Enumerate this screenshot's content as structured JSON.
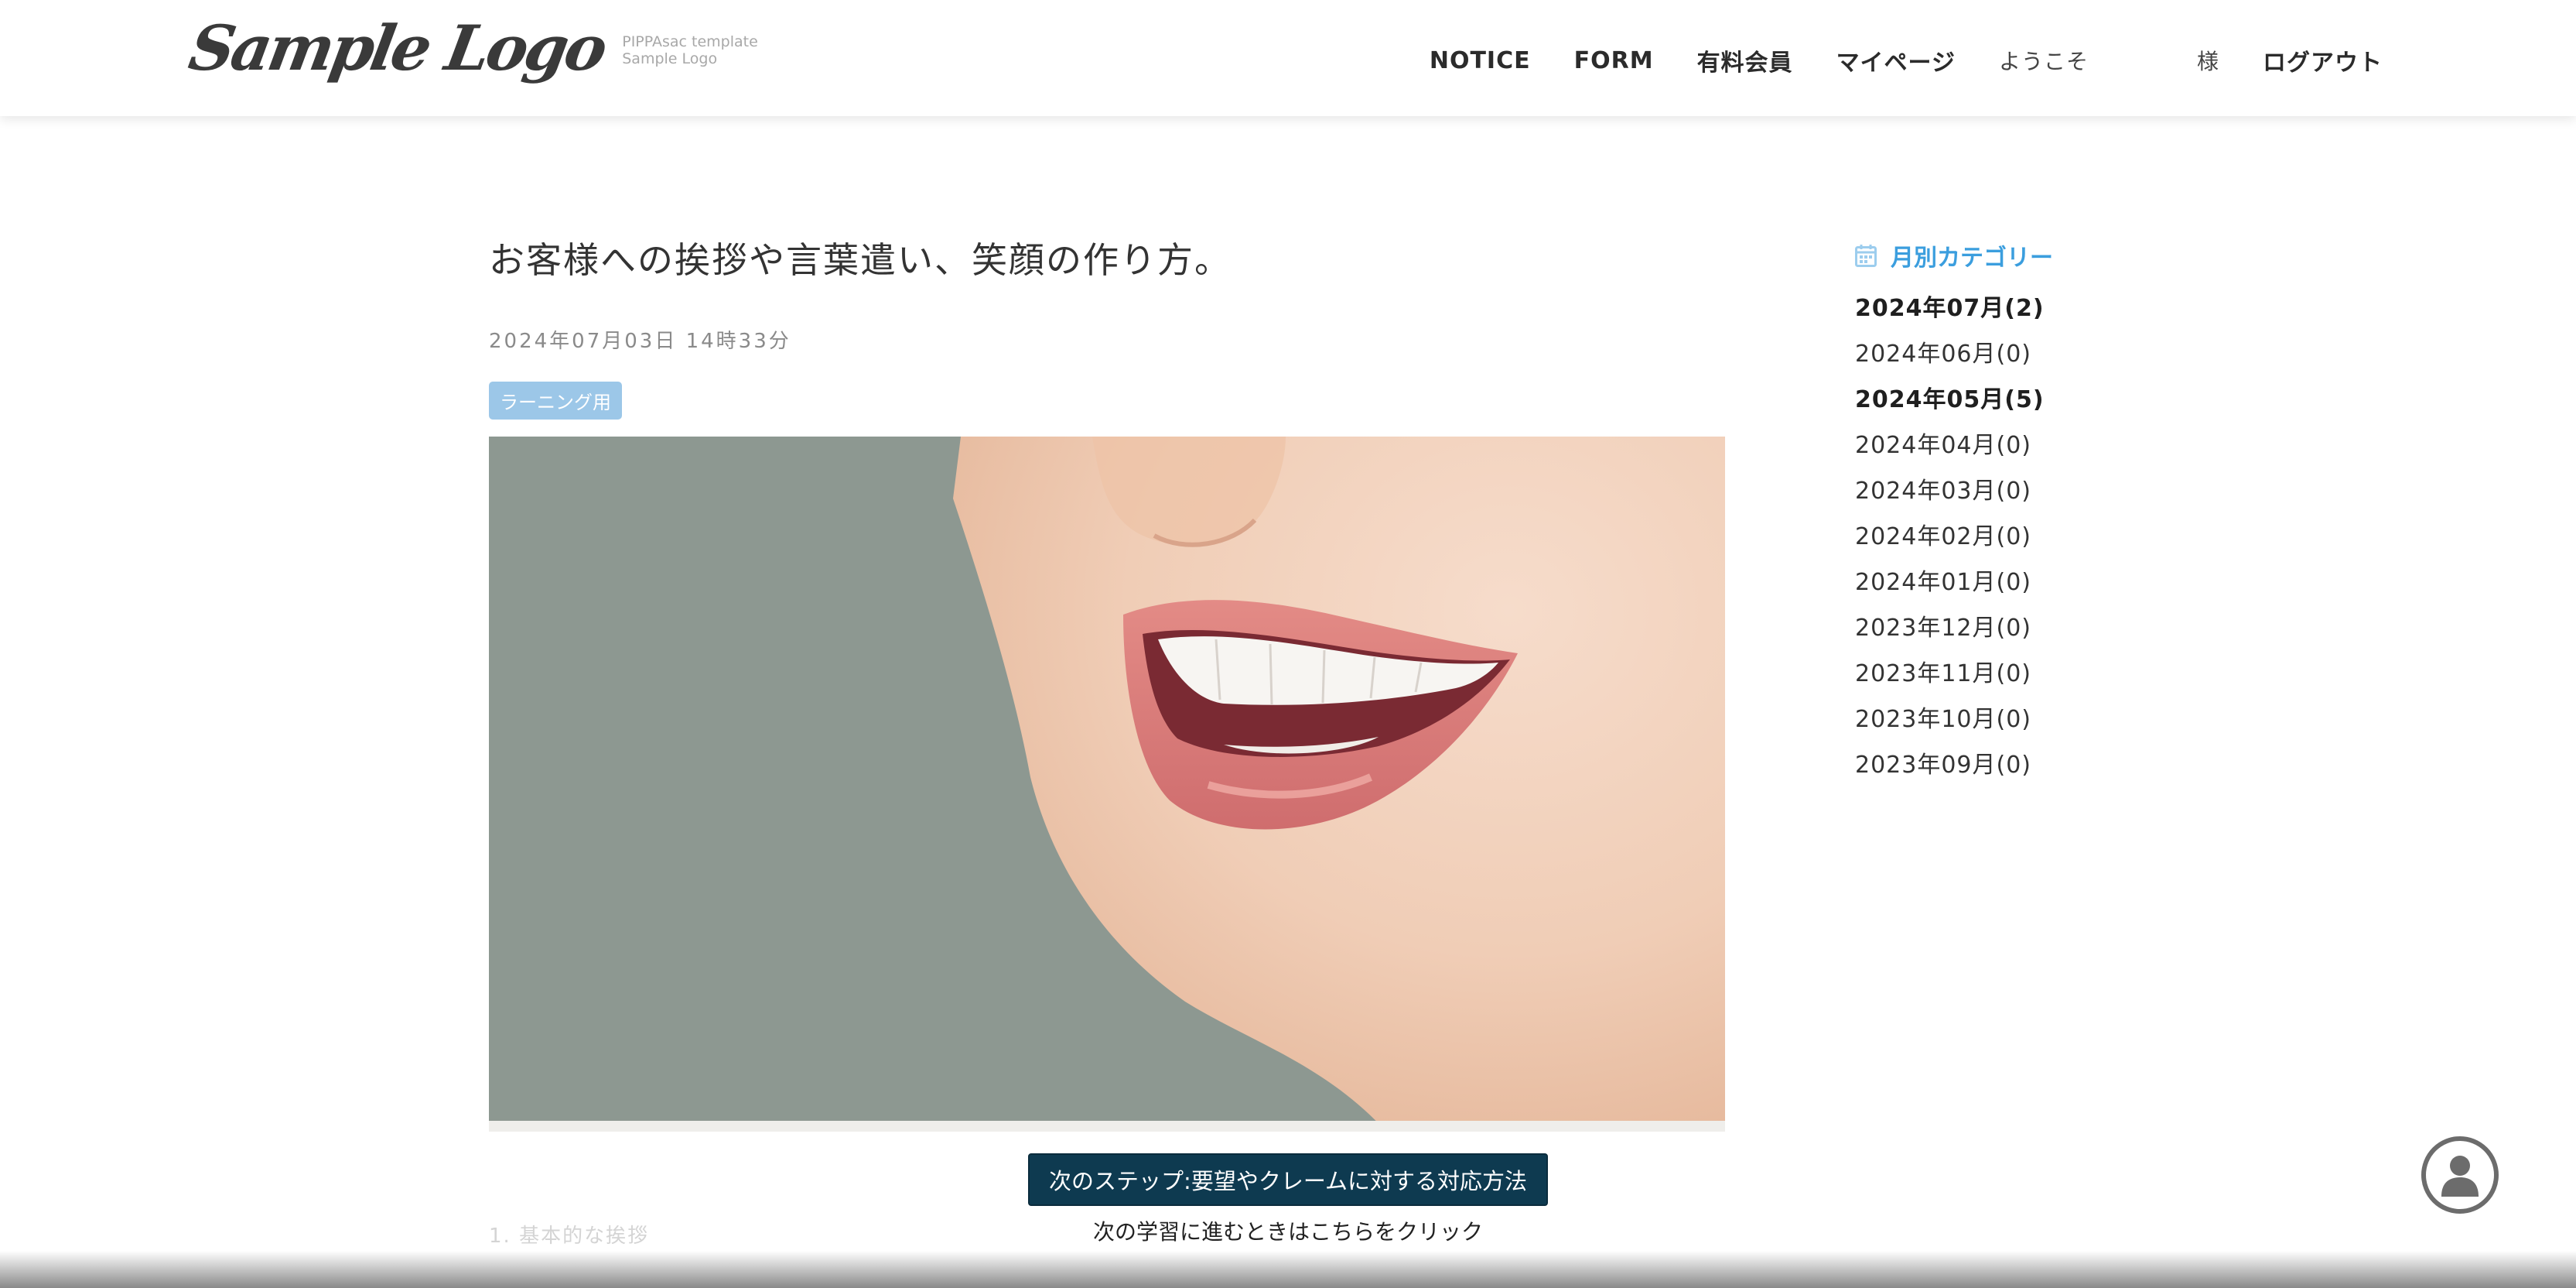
{
  "header": {
    "logo_text": "Sample Logo",
    "logo_sub_line1": "PIPPAsac template",
    "logo_sub_line2": "Sample Logo",
    "nav": {
      "notice": "NOTICE",
      "form": "FORM",
      "paid_member": "有料会員",
      "mypage": "マイページ",
      "welcome": "ようこそ",
      "honorific": "様",
      "logout": "ログアウト"
    }
  },
  "article": {
    "title": "お客様への挨拶や言葉遣い、笑顔の作り方。",
    "date": "2024年07月03日 14時33分",
    "tag": "ラーニング用",
    "image_alt": "smiling-mouth-photo",
    "section_heading": "1. 基本的な挨拶"
  },
  "sidebar": {
    "title": "月別カテゴリー",
    "archive": [
      {
        "label": "2024年07月(2)",
        "bold": true
      },
      {
        "label": "2024年06月(0)",
        "bold": false
      },
      {
        "label": "2024年05月(5)",
        "bold": true
      },
      {
        "label": "2024年04月(0)",
        "bold": false
      },
      {
        "label": "2024年03月(0)",
        "bold": false
      },
      {
        "label": "2024年02月(0)",
        "bold": false
      },
      {
        "label": "2024年01月(0)",
        "bold": false
      },
      {
        "label": "2023年12月(0)",
        "bold": false
      },
      {
        "label": "2023年11月(0)",
        "bold": false
      },
      {
        "label": "2023年10月(0)",
        "bold": false
      },
      {
        "label": "2023年09月(0)",
        "bold": false
      }
    ]
  },
  "next_step": {
    "button_label": "次のステップ:要望やクレームに対する対応方法",
    "hint": "次の学習に進むときはこちらをクリック"
  },
  "colors": {
    "accent_blue": "#3b9ede",
    "tag_bg": "#9cc7e8",
    "button_bg": "#0e3a50",
    "photo_bg": "#8d9891"
  },
  "icons": {
    "sidebar_title": "calendar-icon",
    "floating": "user-icon"
  }
}
